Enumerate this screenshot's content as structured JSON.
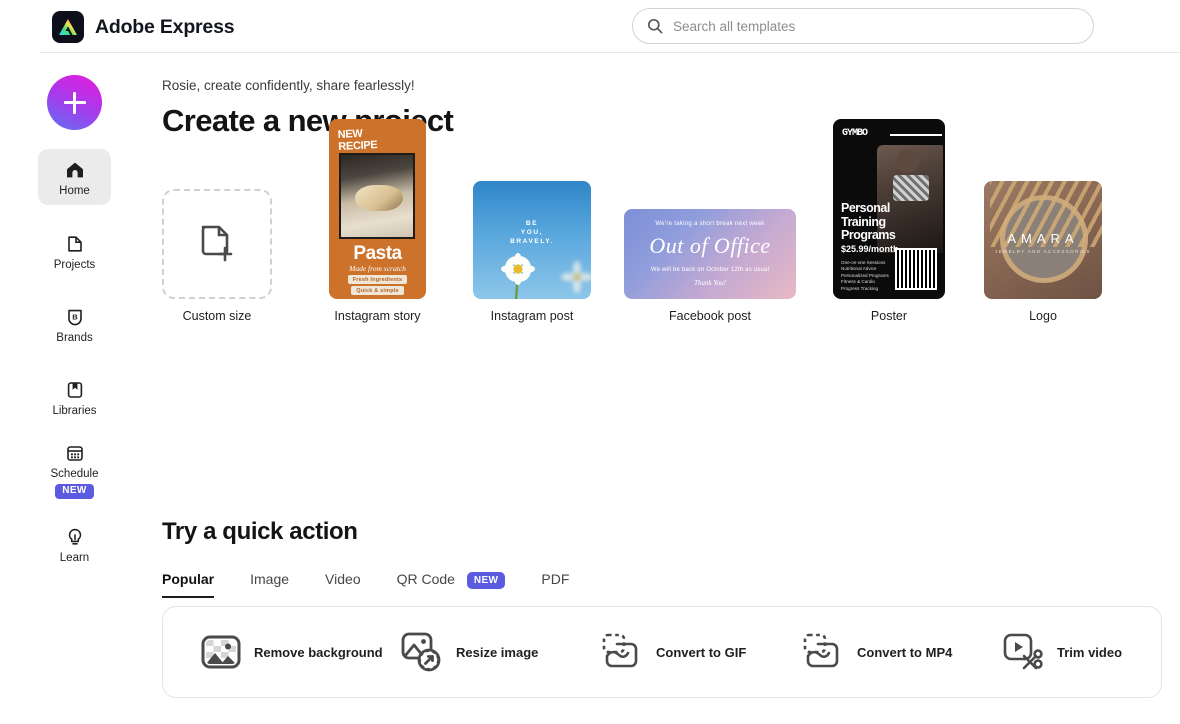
{
  "header": {
    "brand_name": "Adobe Express",
    "logo_icon": "adobe-express-logo",
    "search": {
      "icon": "search-icon",
      "placeholder": "Search all templates",
      "value": ""
    }
  },
  "sidebar": {
    "create_button": {
      "label": "",
      "icon": "plus-icon"
    },
    "items": [
      {
        "label": "Home",
        "icon": "home-icon",
        "active": true
      },
      {
        "label": "Projects",
        "icon": "file-icon",
        "active": false
      },
      {
        "label": "Brands",
        "icon": "brand-shield-icon",
        "active": false
      },
      {
        "label": "Libraries",
        "icon": "book-icon",
        "active": false
      },
      {
        "label": "Schedule",
        "icon": "calendar-icon",
        "active": false,
        "badge": "NEW"
      },
      {
        "label": "Learn",
        "icon": "lightbulb-icon",
        "active": false
      }
    ]
  },
  "main": {
    "greeting": "Rosie, create confidently, share fearlessly!",
    "title": "Create a new project",
    "cards": [
      {
        "label": "Custom size",
        "icon": "document-plus-icon"
      },
      {
        "label": "Instagram story",
        "art": {
          "new_line1": "NEW",
          "new_line2": "RECIPE",
          "title": "Pasta",
          "subtitle": "Made from scratch",
          "tag1": "Fresh Ingredients",
          "tag2": "Quick & simple"
        }
      },
      {
        "label": "Instagram post",
        "art": {
          "text": "BE\nYOU,\nBRAVELY."
        }
      },
      {
        "label": "Facebook post",
        "art": {
          "line1": "We're taking a short break next week",
          "title": "Out of Office",
          "line2": "We will be back on October 12th as usual",
          "line3": "Thank You!"
        }
      },
      {
        "label": "Poster",
        "art": {
          "brand": "GYMBO",
          "headline": "Personal\nTraining\nPrograms",
          "price": "$25.99/month",
          "bullets": "One-on-one Sessions\nNutritional Advice\nPersonalized Programs\nFitness & Cardio\nProgress Tracking"
        }
      },
      {
        "label": "Logo",
        "art": {
          "word": "AMARA",
          "sub": "JEWELRY AND ACCESSORIES"
        }
      }
    ],
    "quick_action": {
      "title": "Try a quick action",
      "tabs": [
        {
          "label": "Popular",
          "active": true
        },
        {
          "label": "Image",
          "active": false
        },
        {
          "label": "Video",
          "active": false
        },
        {
          "label": "QR Code",
          "active": false,
          "badge": "NEW"
        },
        {
          "label": "PDF",
          "active": false
        }
      ],
      "actions": [
        {
          "label": "Remove background",
          "icon": "remove-background-icon"
        },
        {
          "label": "Resize image",
          "icon": "resize-image-icon"
        },
        {
          "label": "Convert to GIF",
          "icon": "convert-shape-icon"
        },
        {
          "label": "Convert to MP4",
          "icon": "convert-shape-icon"
        },
        {
          "label": "Trim video",
          "icon": "trim-video-icon"
        }
      ]
    }
  },
  "colors": {
    "accent_purple": "#5b5be0",
    "story_orange": "#cd722a",
    "poster_black": "#0b0b0b"
  }
}
